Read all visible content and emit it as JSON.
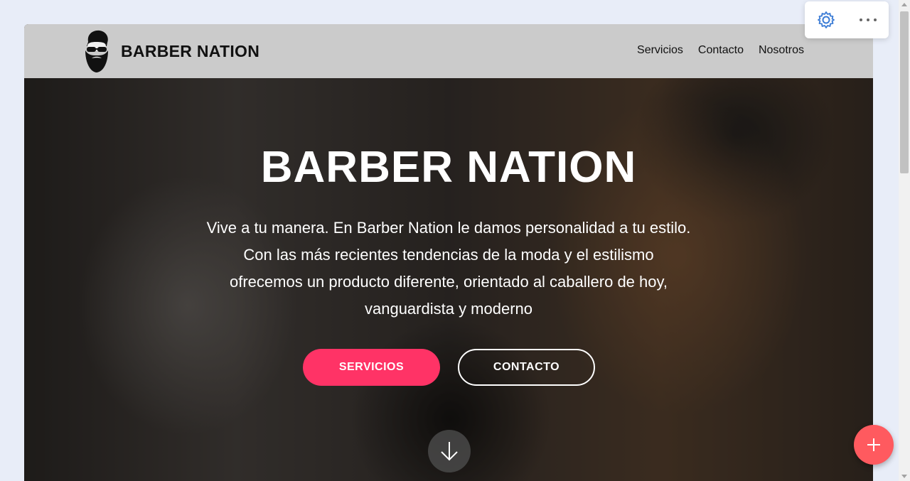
{
  "navbar": {
    "brand_name": "BARBER NATION",
    "logo_icon": "bearded-man-sunglasses-icon",
    "links": [
      "Servicios",
      "Contacto",
      "Nosotros"
    ]
  },
  "hero": {
    "title": "BARBER NATION",
    "lines": [
      "Vive a tu manera. En Barber Nation le damos personalidad a tu estilo.",
      "Con las más recientes tendencias de la moda y el estilismo",
      "ofrecemos un producto diferente, orientado al caballero de hoy,",
      "vanguardista y moderno"
    ],
    "primary_button": "SERVICIOS",
    "secondary_button": "CONTACTO",
    "scroll_icon": "arrow-down-icon"
  },
  "toolbar": {
    "gear_icon": "gear-icon",
    "more_icon": "more-dots-icon"
  },
  "fab": {
    "icon": "plus-icon"
  },
  "colors": {
    "accent": "#ff3366",
    "fab": "#ff5a5f",
    "navbar_bg": "#cbcbcb",
    "toolbar_icon": "#3a7bd5"
  }
}
